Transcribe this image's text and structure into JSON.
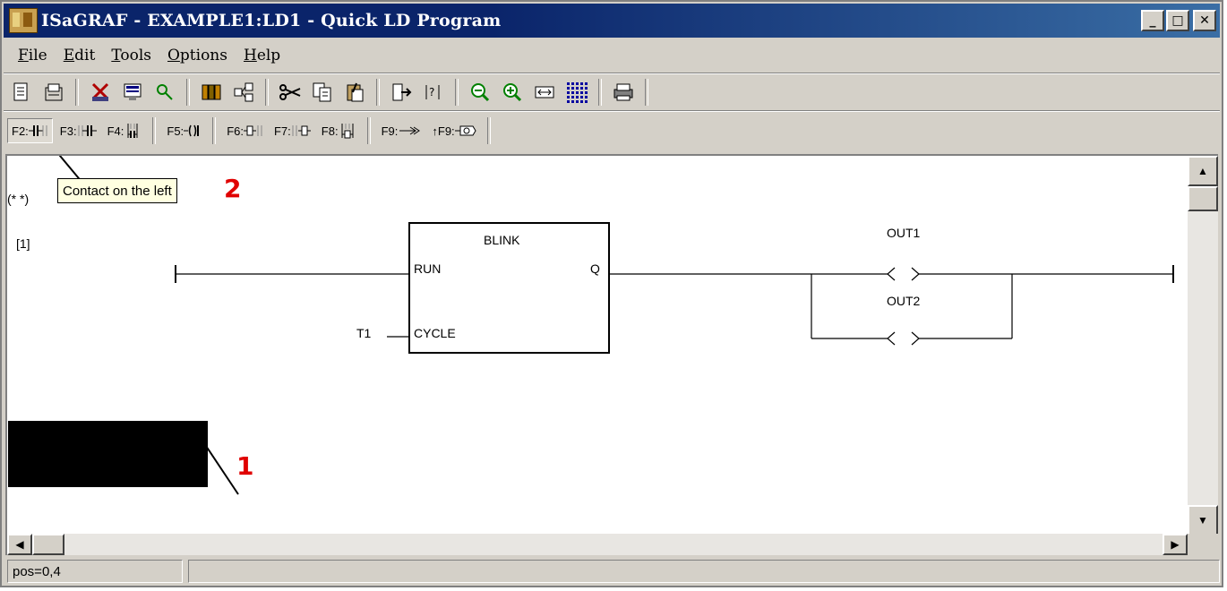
{
  "window": {
    "title": "ISaGRAF - EXAMPLE1:LD1 - Quick LD Program",
    "controls": {
      "minimize": "_",
      "maximize": "□",
      "close": "✕"
    }
  },
  "menu": [
    "File",
    "Edit",
    "Tools",
    "Options",
    "Help"
  ],
  "toolbar1_icons": [
    "new-icon",
    "print-preview-icon",
    "cut-variable-icon",
    "dictionary-icon",
    "search-icon",
    "library-icon",
    "network-icon",
    "cut-icon",
    "copy-icon",
    "paste-icon",
    "insert-icon",
    "comment-icon",
    "zoom-out-icon",
    "zoom-in-icon",
    "fit-icon",
    "grid-icon",
    "printer-icon"
  ],
  "toolbar2": {
    "f2": "F2:",
    "f3": "F3:",
    "f4": "F4:",
    "f5": "F5:",
    "f6": "F6:",
    "f7": "F7:",
    "f8": "F8:",
    "f9": "F9:",
    "sf9": "↑F9:"
  },
  "tooltip": "Contact on the left",
  "annotations": {
    "two": "2",
    "one": "1"
  },
  "ladder": {
    "comment": "(* *)",
    "rung_number": "[1]",
    "block_name": "BLINK",
    "in_run": "RUN",
    "in_cycle": "CYCLE",
    "out_q": "Q",
    "cycle_var": "T1",
    "coil1": "OUT1",
    "coil2": "OUT2"
  },
  "status": {
    "position": "pos=0,4",
    "message": ""
  },
  "colors": {
    "title_bg": "#0a246a",
    "annotation": "#e00000",
    "tooltip_bg": "#ffffe1"
  }
}
